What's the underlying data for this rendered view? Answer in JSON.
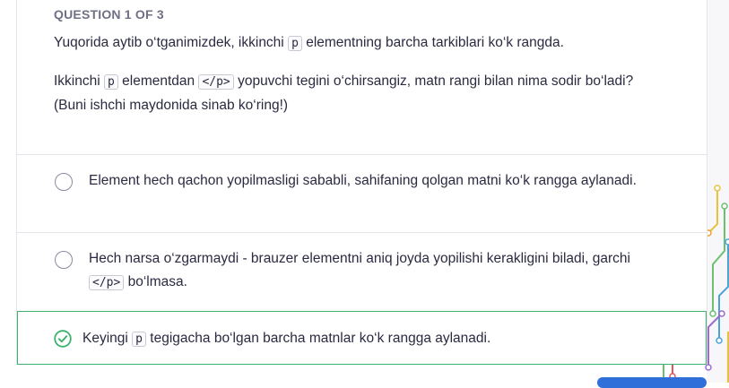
{
  "question": {
    "header": "QUESTION 1 OF 3",
    "intro_before": "Yuqorida aytib o‘tganimizdek, ikkinchi ",
    "intro_code": "p",
    "intro_after": " elementning barcha tarkiblari ko‘k rangda.",
    "prompt_a": "Ikkinchi ",
    "prompt_code1": "p",
    "prompt_b": " elementdan ",
    "prompt_code2": "</p>",
    "prompt_c": " yopuvchi tegini o‘chirsangiz, matn rangi bilan nima sodir bo‘ladi? (Buni ishchi maydonida sinab ko‘ring!)"
  },
  "options": [
    {
      "text": "Element hech qachon yopilmasligi sababli, sahifaning qolgan matni ko‘k rangga aylanadi."
    },
    {
      "text_before": "Hech narsa o‘zgarmaydi - brauzer elementni aniq joyda yopilishi kerakligini biladi, garchi ",
      "code": "</p>",
      "text_after": " bo‘lmasa."
    },
    {
      "text_before": "Keyingi ",
      "code": "p",
      "text_after": " tegigacha bo‘lgan barcha matnlar ko‘k rangga aylanadi.",
      "state": "correct"
    }
  ],
  "colors": {
    "correct": "#3cb26b",
    "radio_border": "#8a8aa0",
    "accent": "#2f6fd9"
  },
  "icons": {
    "correct_marker": "check-circle-icon"
  }
}
